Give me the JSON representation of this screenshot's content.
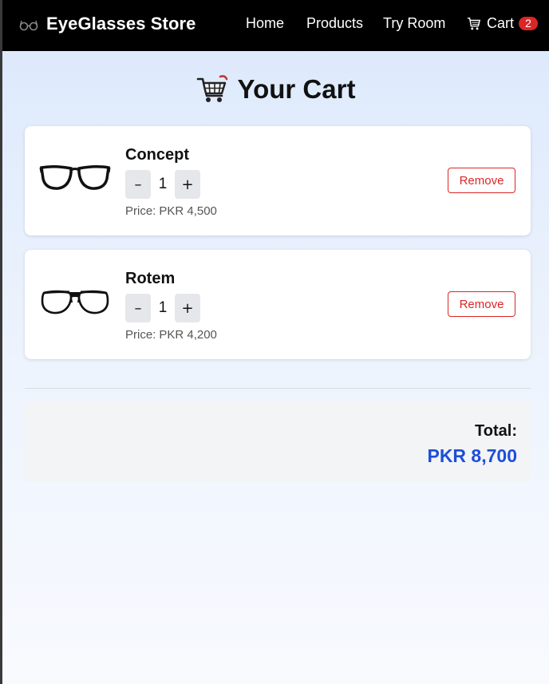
{
  "navbar": {
    "brand_icon": "glasses-icon",
    "brand": "EyeGlasses Store",
    "links": {
      "home": "Home",
      "products": "Products",
      "try_room": "Try Room",
      "cart": "Cart"
    },
    "cart_icon": "cart-icon",
    "cart_count": "2"
  },
  "page": {
    "title_icon": "shopping-cart-icon",
    "title": "Your Cart"
  },
  "cart": {
    "items": [
      {
        "name": "Concept",
        "image_icon": "eyeglasses-concept-icon",
        "quantity": "1",
        "decrement_label": "–",
        "increment_label": "+",
        "price_label": "Price:",
        "price": "PKR 4,500",
        "remove_label": "Remove"
      },
      {
        "name": "Rotem",
        "image_icon": "eyeglasses-rotem-icon",
        "quantity": "1",
        "decrement_label": "–",
        "increment_label": "+",
        "price_label": "Price:",
        "price": "PKR 4,200",
        "remove_label": "Remove"
      }
    ]
  },
  "summary": {
    "total_label": "Total:",
    "total_value": "PKR 8,700"
  },
  "colors": {
    "navbar_bg": "#000000",
    "badge": "#dc2626",
    "remove": "#dc2626",
    "total_value": "#1d4ed8"
  }
}
